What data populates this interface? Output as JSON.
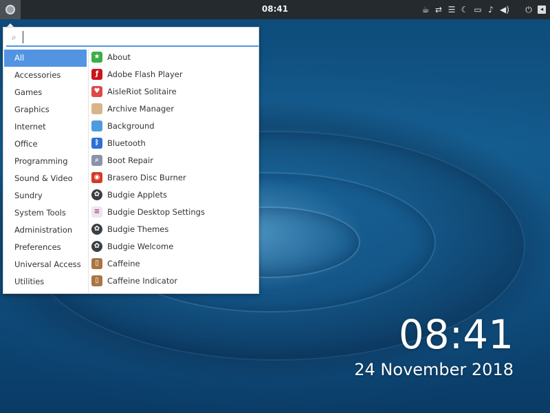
{
  "panel": {
    "clock": "08:41",
    "tray_icons": [
      "coffee-icon",
      "network-icon",
      "notifications-list-icon",
      "night-light-icon",
      "folder-icon",
      "bell-icon",
      "volume-icon",
      "power-icon",
      "show-desktop-icon"
    ]
  },
  "menu": {
    "search_value": "",
    "categories": [
      {
        "label": "All",
        "active": true
      },
      {
        "label": "Accessories"
      },
      {
        "label": "Games"
      },
      {
        "label": "Graphics"
      },
      {
        "label": "Internet"
      },
      {
        "label": "Office"
      },
      {
        "label": "Programming"
      },
      {
        "label": "Sound & Video"
      },
      {
        "label": "Sundry"
      },
      {
        "label": "System Tools"
      },
      {
        "label": "Administration"
      },
      {
        "label": "Preferences"
      },
      {
        "label": "Universal Access"
      },
      {
        "label": "Utilities"
      }
    ],
    "apps": [
      {
        "label": "About",
        "icon": "star-icon",
        "color": "#3bae49"
      },
      {
        "label": "Adobe Flash Player",
        "icon": "flash-icon",
        "color": "#c8161d"
      },
      {
        "label": "AisleRiot Solitaire",
        "icon": "heart-card-icon",
        "color": "#e04848"
      },
      {
        "label": "Archive Manager",
        "icon": "archive-icon",
        "color": "#d9b48a"
      },
      {
        "label": "Background",
        "icon": "background-icon",
        "color": "#4f9be0"
      },
      {
        "label": "Bluetooth",
        "icon": "bluetooth-icon",
        "color": "#2f6fd6"
      },
      {
        "label": "Boot Repair",
        "icon": "magnifier-icon",
        "color": "#8a93a8"
      },
      {
        "label": "Brasero Disc Burner",
        "icon": "disc-icon",
        "color": "#d23a2a"
      },
      {
        "label": "Budgie Applets",
        "icon": "budgie-icon",
        "color": "#3a3f44"
      },
      {
        "label": "Budgie Desktop Settings",
        "icon": "toggle-settings-icon",
        "color": "#e8e8ee"
      },
      {
        "label": "Budgie Themes",
        "icon": "budgie-icon",
        "color": "#3a3f44"
      },
      {
        "label": "Budgie Welcome",
        "icon": "budgie-icon",
        "color": "#3a3f44"
      },
      {
        "label": "Caffeine",
        "icon": "coffee-cup-icon",
        "color": "#a97443"
      },
      {
        "label": "Caffeine Indicator",
        "icon": "coffee-cup-icon",
        "color": "#a97443"
      }
    ]
  },
  "desktop_clock": {
    "time": "08:41",
    "date": "24 November 2018"
  }
}
